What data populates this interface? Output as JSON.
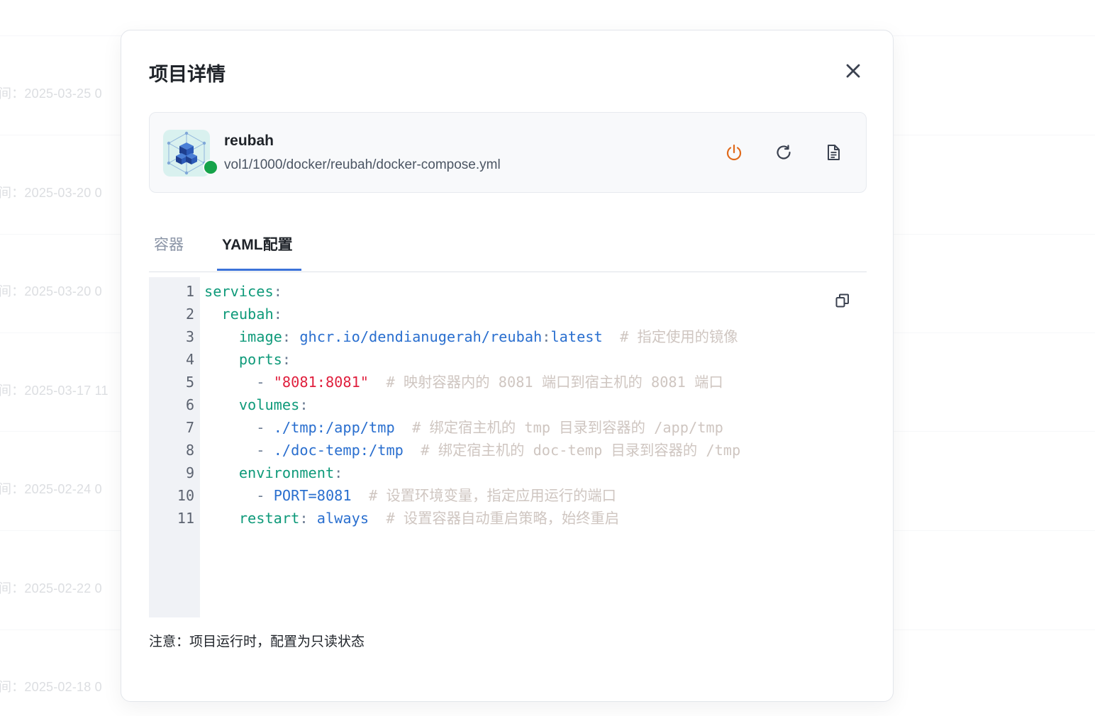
{
  "background": {
    "dates": [
      "间：2025-03-25 0",
      "间：2025-03-20 0",
      "间：2025-03-20 0",
      "间：2025-03-17 11",
      "间：2025-02-24 0",
      "间：2025-02-22 0",
      "间：2025-02-18 0"
    ]
  },
  "modal": {
    "title": "项目详情",
    "close_icon": "close-icon"
  },
  "project": {
    "name": "reubah",
    "path": "vol1/1000/docker/reubah/docker-compose.yml",
    "status": "running",
    "status_color": "#16a34a",
    "icon": "cube-stack-icon",
    "actions": [
      {
        "name": "power-icon",
        "color": "#e06a1b"
      },
      {
        "name": "restart-icon",
        "color": "#3b4250"
      },
      {
        "name": "document-icon",
        "color": "#3b4250"
      }
    ]
  },
  "tabs": [
    {
      "label": "容器",
      "active": false
    },
    {
      "label": "YAML配置",
      "active": true
    }
  ],
  "colors": {
    "accent": "#3b72d9",
    "key": "#0f9a7a",
    "value": "#2a6fcf",
    "string": "#e0203e",
    "comment": "#cfc6c1"
  },
  "editor": {
    "line_numbers": [
      "1",
      "2",
      "3",
      "4",
      "5",
      "6",
      "7",
      "8",
      "9",
      "10",
      "11"
    ],
    "lines": [
      {
        "key": "services",
        "colon": ":"
      },
      {
        "key": "reubah",
        "colon": ":"
      },
      {
        "key": "image",
        "colon": ":",
        "value": "ghcr.io/dendianugerah/reubah",
        "colon2": ":",
        "value2": "latest",
        "comment": "# 指定使用的镜像"
      },
      {
        "key": "ports",
        "colon": ":"
      },
      {
        "dash": "-",
        "string": "\"8081:8081\"",
        "comment": "# 映射容器内的 8081 端口到宿主机的 8081 端口"
      },
      {
        "key": "volumes",
        "colon": ":"
      },
      {
        "dash": "-",
        "value": "./tmp:/app/tmp",
        "comment": "# 绑定宿主机的 tmp 目录到容器的 /app/tmp"
      },
      {
        "dash": "-",
        "value": "./doc-temp:/tmp",
        "comment": "# 绑定宿主机的 doc-temp 目录到容器的 /tmp"
      },
      {
        "key": "environment",
        "colon": ":"
      },
      {
        "dash": "-",
        "value": "PORT=8081",
        "comment": "# 设置环境变量，指定应用运行的端口"
      },
      {
        "key": "restart",
        "colon": ":",
        "value": "always",
        "comment": "# 设置容器自动重启策略，始终重启"
      }
    ],
    "copy_icon": "copy-icon"
  },
  "note": "注意：项目运行时，配置为只读状态"
}
